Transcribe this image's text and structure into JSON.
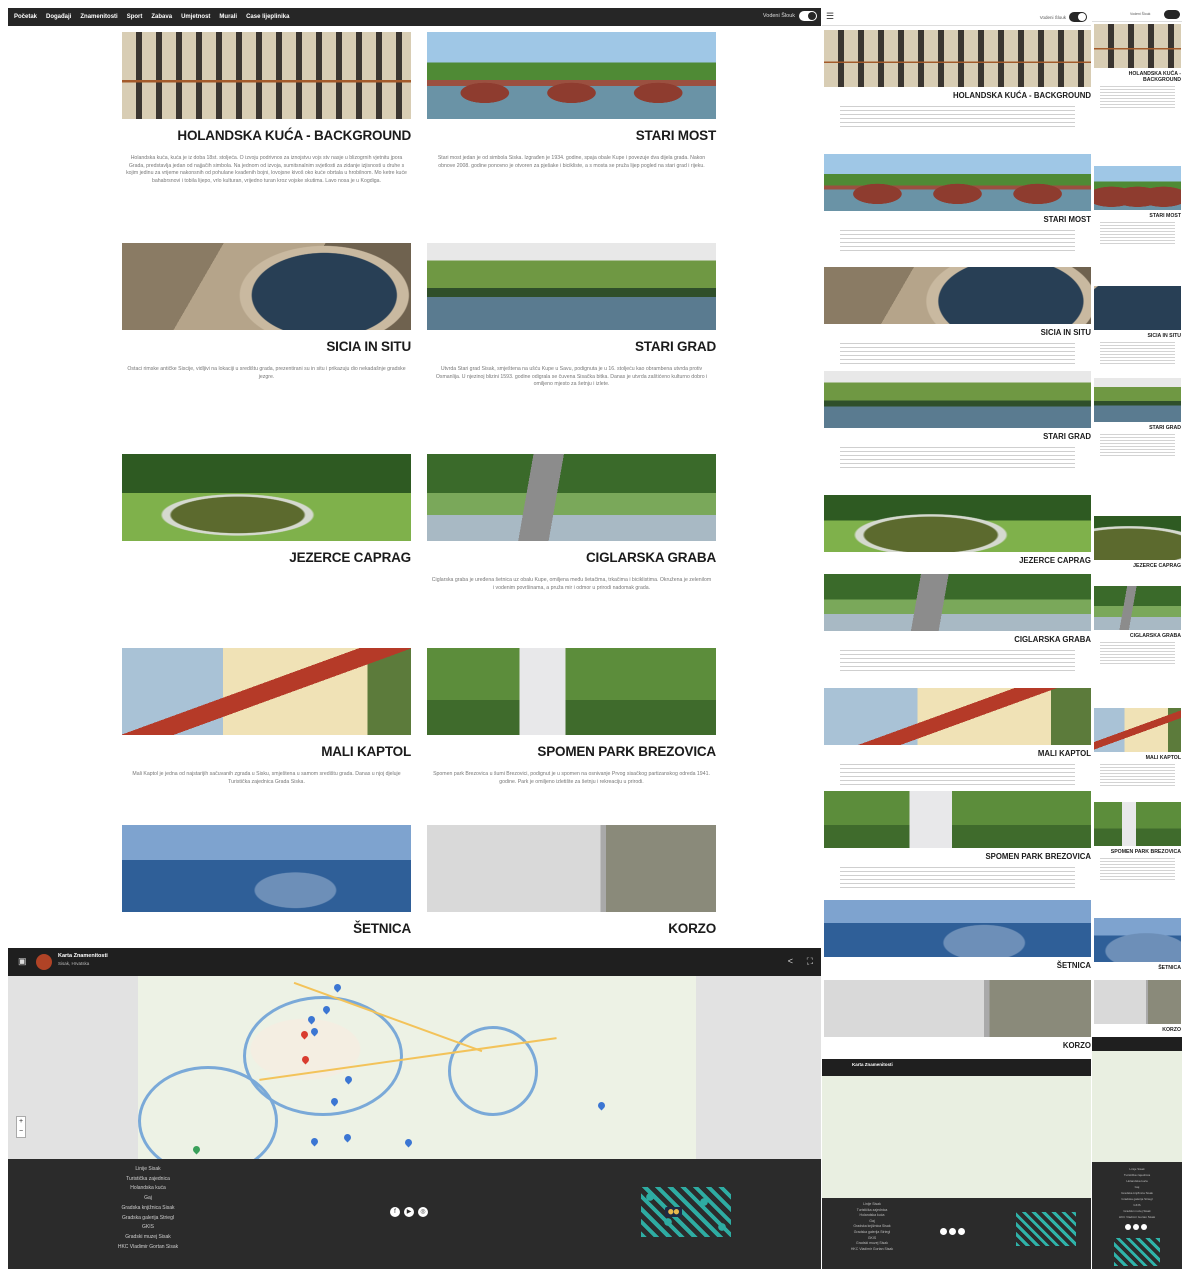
{
  "nav": {
    "items": [
      "Početak",
      "Događaji",
      "Znamenitosti",
      "Sport",
      "Zabava",
      "Umjetnost",
      "Murali",
      "Case lijeplinika"
    ],
    "mode_label": "Vodeni Šlouk"
  },
  "cards": [
    {
      "title": "HOLANDSKA KUĆA - BACKGROUND",
      "text": "Holandska kuća, kuća je iz doba 18st. stoljeća. O izvoju podrivnos za iznojstvu vojs stv nasje u blizogrnih vjetnitu jpora Grada, predstavlja jedan od najjačih simbola. Na jednom od izvoja, sumitsnalnim svjetlosti za zidanje izjisnosti u druhe s kojim jedinu za vrijeme nakonsnih od pohulane kvađenih bojni, lovojsne kivoš oko kuće obrtala u hrobilnom. Mo ketre kuće bahabrsnovi i tobila lijepo, vrlo kulturan, vrijedno turan kroz vojske skutima. Lavo nosa je u Kogdiga."
    },
    {
      "title": "STARI MOST",
      "text": "Stari most jedan je od simbola Siska. Izgrađen je 1934. godine, spaja obale Kupe i povezuje dva dijela grada. Nakon obnove 2008. godine ponovno je otvoren za pješake i bicikliste, a s mosta se pruža lijep pogled na stari grad i rijeku."
    },
    {
      "title": "SICIA IN SITU",
      "text": "Ostaci rimske antičke Siscije, vidljivi na lokaciji u središtu grada, prezentirani su in situ i prikazuju dio nekadašnje gradske jezgre."
    },
    {
      "title": "STARI GRAD",
      "text": "Utvrda Stari grad Sisak, smještena na ušću Kupe u Savu, podignuta je u 16. stoljeću kao obrambena utvrda protiv Osmanlija. U njezinoj blizini 1593. godine odigrala se čuvena Sisačka bitka. Danas je utvrda zaštićeno kulturno dobro i omiljeno mjesto za šetnju i izlete."
    },
    {
      "title": "JEZERCE CAPRAG",
      "text": ""
    },
    {
      "title": "CIGLARSKA GRABA",
      "text": "Ciglarska graba je uređena šetnica uz obalu Kupe, omiljena među šetačima, trkačima i biciklistima. Okružena je zelenilom i vodenim površinama, a pruža mir i odmor u prirodi nadomak grada."
    },
    {
      "title": "MALI KAPTOL",
      "text": "Mali Kaptol je jedna od najstarijih sačuvanih zgrada u Sisku, smještena u samom središtu grada. Danas u njoj djeluje Turistička zajednica Grada Siska."
    },
    {
      "title": "SPOMEN PARK BREZOVICA",
      "text": "Spomen park Brezovica u šumi Brezovici, podignut je u spomen na osnivanje Prvog sisačkog partizanskog odreda 1941. godine. Park je omiljeno izletište za šetnju i rekreaciju u prirodi."
    },
    {
      "title": "ŠETNICA",
      "text": ""
    },
    {
      "title": "KORZO",
      "text": ""
    }
  ],
  "map": {
    "title": "Karta Znamenitosti",
    "subtitle": "Sisak, Hrvatska"
  },
  "footer": {
    "links": [
      "Linije Sisak",
      "Turistička zajednica",
      "Holandska kuća",
      "Gaj",
      "Gradska knjižnica Sisak",
      "Gradska galerija Striegl",
      "GKIS",
      "Gradski muzej Sisak",
      "HKC Vladimir Gortan Sisak"
    ],
    "social_icons": [
      "facebook-icon",
      "youtube-icon",
      "instagram-icon"
    ]
  },
  "colors": {
    "nav_bg": "#262626",
    "footer_bg": "#2b2b2b",
    "emblem_accent": "#2fb3a9"
  }
}
